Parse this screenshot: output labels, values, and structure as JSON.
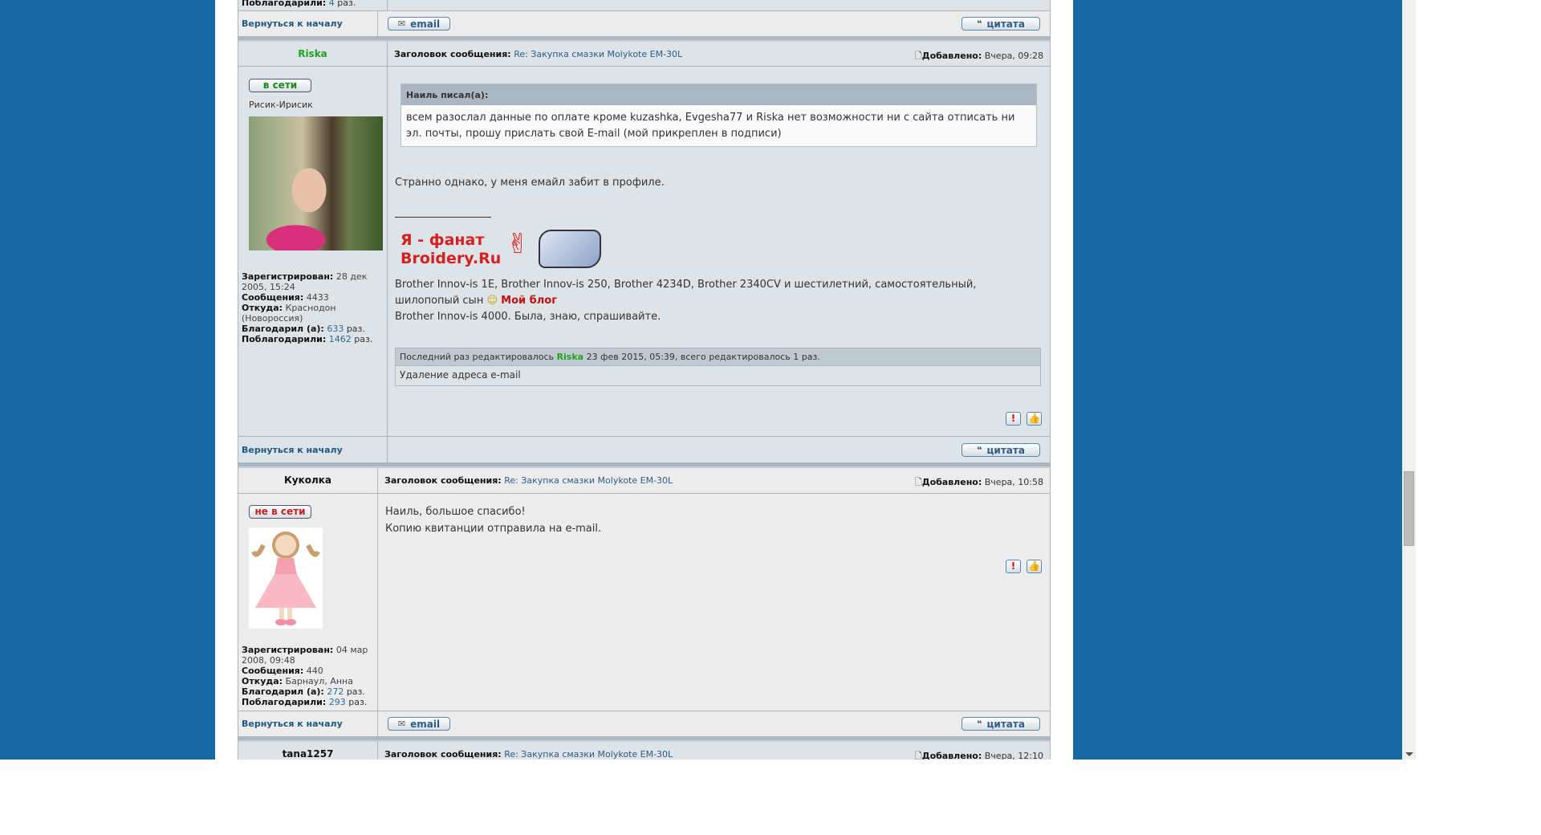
{
  "common": {
    "back_to_top": "Вернуться к началу",
    "email_button": "email",
    "quote_button": "цитата",
    "subject_label": "Заголовок сообщения:",
    "subject": "Re: Закупка смазки Molykote EM-30L",
    "added_label": "Добавлено:",
    "registered_label": "Зарегистрирован:",
    "posts_label": "Сообщения:",
    "from_label": "Откуда:",
    "thanked_label": "Благодарил (а):",
    "thanked_by_label": "Поблагодарили:",
    "times": "раз."
  },
  "previous_post": {
    "thanked_by_label": "Поблагодарили:",
    "thanked_by": "4",
    "times": "раз."
  },
  "posts": [
    {
      "author": "Riska",
      "author_color": "#22a022",
      "status": "в сети",
      "status_color": "#1a8a1a",
      "rank": "Рисик-Ирисик",
      "added": "Вчера, 09:28",
      "registered": "28 дек 2005, 15:24",
      "posts": "4433",
      "from": "Краснодон (Новороссия)",
      "thanked": "633",
      "thanked_by": "1462",
      "quote_author": "Наиль писал(а):",
      "quote_text": "всем разослал данные по оплате кроме kuzashka, Evgesha77 и Riska нет возможности ни с сайта отписать ни эл. почты, прошу прислать свой E-mail (мой прикреплен в подписи)",
      "body": "Странно однако, у меня емайл забит в профиле.",
      "signature_banner": "Я - фанат Broidery.Ru",
      "signature_line1": "Brother Innov-is 1E, Brother Innov-is 250, Brother 4234D, Brother 2340CV и шестилетний, самостоятельный, шилопопый сын",
      "signature_blog": "Мой блог",
      "signature_line2": "Brother Innov-is 4000. Была, знаю, спрашивайте.",
      "edit_prefix": "Последний раз редактировалось",
      "edit_user": "Riska",
      "edit_suffix": "23 фев 2015, 05:39, всего редактировалось 1 раз.",
      "edit_reason": "Удаление адреса e-mail"
    },
    {
      "author": "Куколка",
      "status": "не в сети",
      "status_color": "#c02020",
      "added": "Вчера, 10:58",
      "registered": "04 мар 2008, 09:48",
      "posts": "440",
      "from": "Барнаул, Анна",
      "thanked": "272",
      "thanked_by": "293",
      "body_line1": "Наиль, большое спасибо!",
      "body_line2": "Копию квитанции отправила на e-mail."
    },
    {
      "author": "tana1257",
      "added": "Вчера, 12:10"
    }
  ]
}
